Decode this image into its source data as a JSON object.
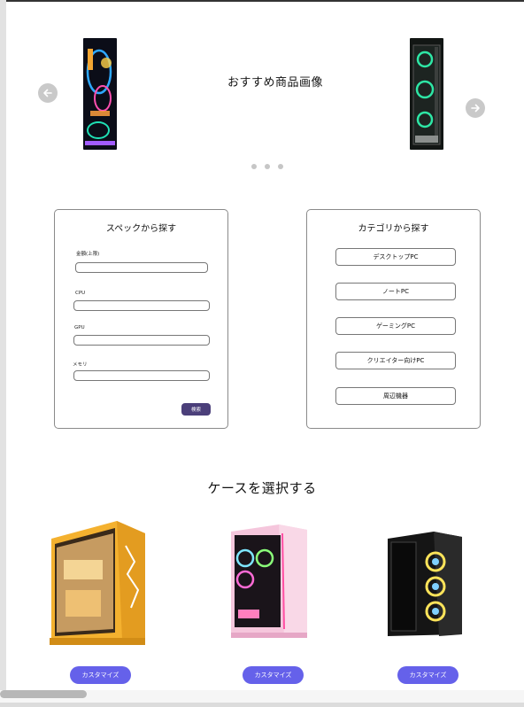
{
  "carousel": {
    "title": "おすすめ商品画像",
    "prev_icon": "arrow-left-icon",
    "next_icon": "arrow-right-icon",
    "dot_count": 3
  },
  "spec_search": {
    "title": "スペックから探す",
    "fields": [
      {
        "label": "金額(上限)",
        "value": ""
      },
      {
        "label": "CPU",
        "value": ""
      },
      {
        "label": "GPU",
        "value": ""
      },
      {
        "label": "メモリ",
        "value": ""
      }
    ],
    "search_label": "検索"
  },
  "category_search": {
    "title": "カテゴリから探す",
    "items": [
      "デスクトップPC",
      "ノートPC",
      "ゲーミングPC",
      "クリエイター向けPC",
      "周辺機器"
    ]
  },
  "cases": {
    "title": "ケースを選択する",
    "customize_label": "カスタマイズ"
  },
  "colors": {
    "search_button": "#4b3f7a",
    "customize_button": "#6561ea"
  }
}
